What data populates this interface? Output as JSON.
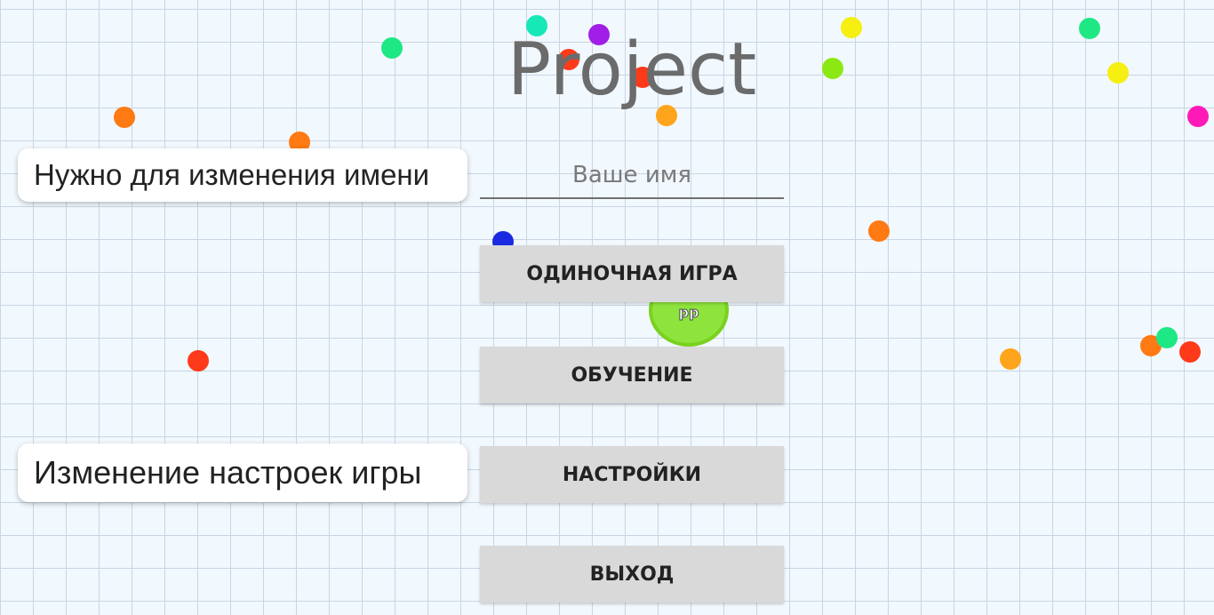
{
  "app": {
    "title": "Project"
  },
  "name_field": {
    "placeholder": "Ваше имя"
  },
  "menu": {
    "single_player": "ОДИНОЧНАЯ ИГРА",
    "tutorial": "ОБУЧЕНИЕ",
    "settings": "НАСТРОЙКИ",
    "exit": "ВЫХОД"
  },
  "player": {
    "name": "dd"
  },
  "annotations": {
    "name_hint": "Нужно для изменения имени",
    "settings_hint": "Изменение настроек игры"
  },
  "colors": {
    "background": "#f1f8fe",
    "grid": "#c9d6e2",
    "button": "#d9d9d9",
    "player_cell": "#8ee43c"
  },
  "pellet_colors": [
    "#ff7a13",
    "#ff3a1a",
    "#ffa51b",
    "#f5ef12",
    "#8ce812",
    "#1ee884",
    "#16e8b8",
    "#1a2ae0",
    "#a01ee8",
    "#ff1ab8"
  ]
}
